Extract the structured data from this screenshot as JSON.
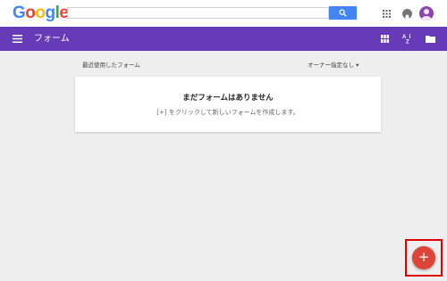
{
  "google_bar": {
    "logo_letters": [
      {
        "ch": "G",
        "color": "#4285f4"
      },
      {
        "ch": "o",
        "color": "#ea4335"
      },
      {
        "ch": "o",
        "color": "#fbbc05"
      },
      {
        "ch": "g",
        "color": "#4285f4"
      },
      {
        "ch": "l",
        "color": "#34a853"
      },
      {
        "ch": "e",
        "color": "#ea4335"
      }
    ],
    "search_value": "",
    "icons": [
      "search-icon",
      "apps-grid-icon",
      "notifications-icon",
      "account-avatar"
    ]
  },
  "app_bar": {
    "title": "フォーム",
    "color": "#673ab7",
    "icons": [
      "menu-icon",
      "grid-view-icon",
      "sort-az-icon",
      "folder-icon"
    ]
  },
  "main": {
    "section_label": "最近使用したフォーム",
    "owner_filter": "オーナー指定なし ▾",
    "empty_state": {
      "title": "まだフォームはありません",
      "description": "[+] をクリックして新しいフォームを作成します。"
    }
  },
  "fab": {
    "label": "+",
    "color": "#db4437",
    "highlighted": true
  }
}
